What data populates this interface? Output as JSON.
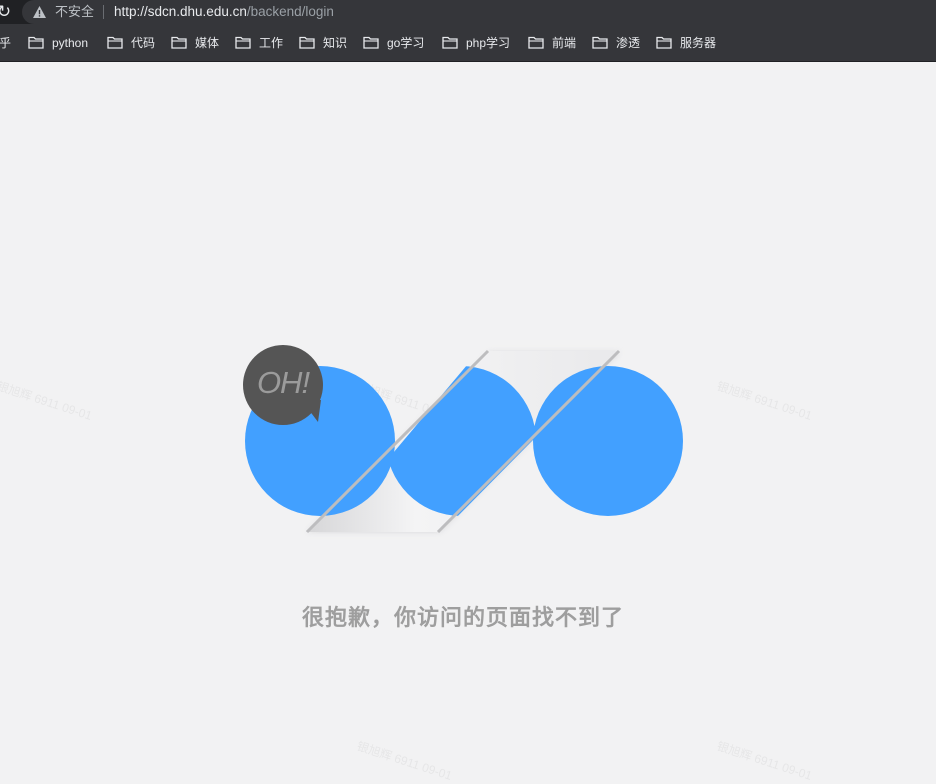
{
  "browser": {
    "security_label": "不安全",
    "url_host": "http://sdcn.dhu.edu.cn",
    "url_path": "/backend/login",
    "bookmarks": [
      {
        "label": "乎"
      },
      {
        "label": "python"
      },
      {
        "label": "代码"
      },
      {
        "label": "媒体"
      },
      {
        "label": "工作"
      },
      {
        "label": "知识"
      },
      {
        "label": "go学习"
      },
      {
        "label": "php学习"
      },
      {
        "label": "前端"
      },
      {
        "label": "渗透"
      },
      {
        "label": "服务器"
      }
    ]
  },
  "page": {
    "bubble_text": "OH!",
    "error_message": "很抱歉，你访问的页面找不到了",
    "watermark": "银旭辉 6911 09-01"
  },
  "colors": {
    "circle_blue": "#42a0ff",
    "bubble_dark": "#555555",
    "page_background": "#f2f2f3"
  },
  "icons": {
    "reload": "reload-icon",
    "security": "warning-triangle-icon",
    "bookmark": "folder-icon"
  }
}
